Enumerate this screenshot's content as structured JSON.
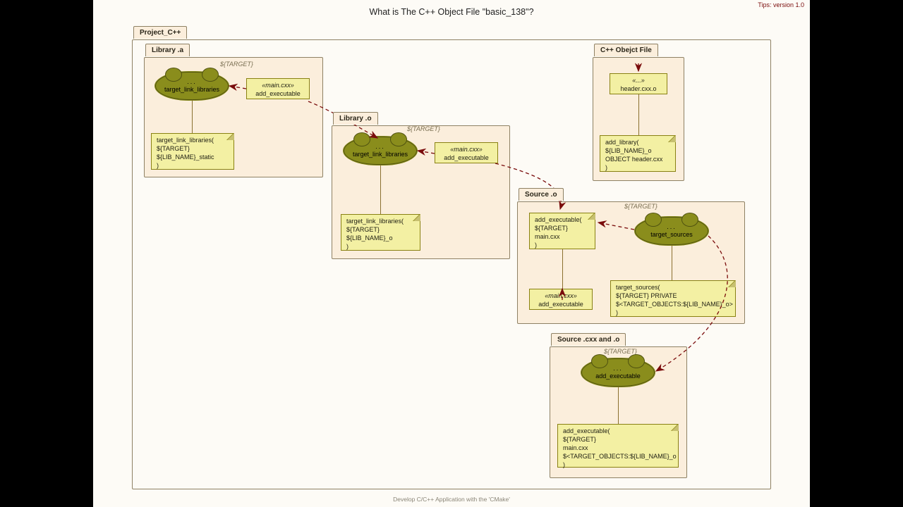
{
  "meta": {
    "tips": "Tips: version 1.0",
    "footer": "Develop C/C++ Application with the 'CMake'"
  },
  "title": "What is The C++ Object File \"basic_138\"?",
  "project_tab": "Project_C++",
  "target_label": "${TARGET}",
  "dots": "...",
  "main_stereo": "«main.cxx»",
  "add_exec": "add_executable",
  "lib_a": {
    "tab": "Library .a",
    "cloud": "target_link_libraries",
    "note": "target_link_libraries(\n  ${TARGET}\n  ${LIB_NAME}_static\n)"
  },
  "lib_o": {
    "tab": "Library .o",
    "cloud": "target_link_libraries",
    "note": "target_link_libraries(\n  ${TARGET}\n  ${LIB_NAME}_o\n)"
  },
  "obj_file": {
    "tab": "C++ Obejct File",
    "stereo": "«...»",
    "header": "header.cxx.o",
    "note": "add_library(\n  ${LIB_NAME}_o\n  OBJECT header.cxx\n)"
  },
  "source_o": {
    "tab": "Source .o",
    "cloud": "target_sources",
    "exec_note": "add_executable(\n  ${TARGET}\n  main.cxx\n)",
    "src_note": "target_sources(\n  ${TARGET} PRIVATE\n  $<TARGET_OBJECTS:${LIB_NAME}_o>\n)"
  },
  "source_cxx": {
    "tab": "Source .cxx and .o",
    "cloud": "add_executable",
    "note": "add_executable(\n  ${TARGET}\n  main.cxx\n  $<TARGET_OBJECTS:${LIB_NAME}_o\n)"
  }
}
